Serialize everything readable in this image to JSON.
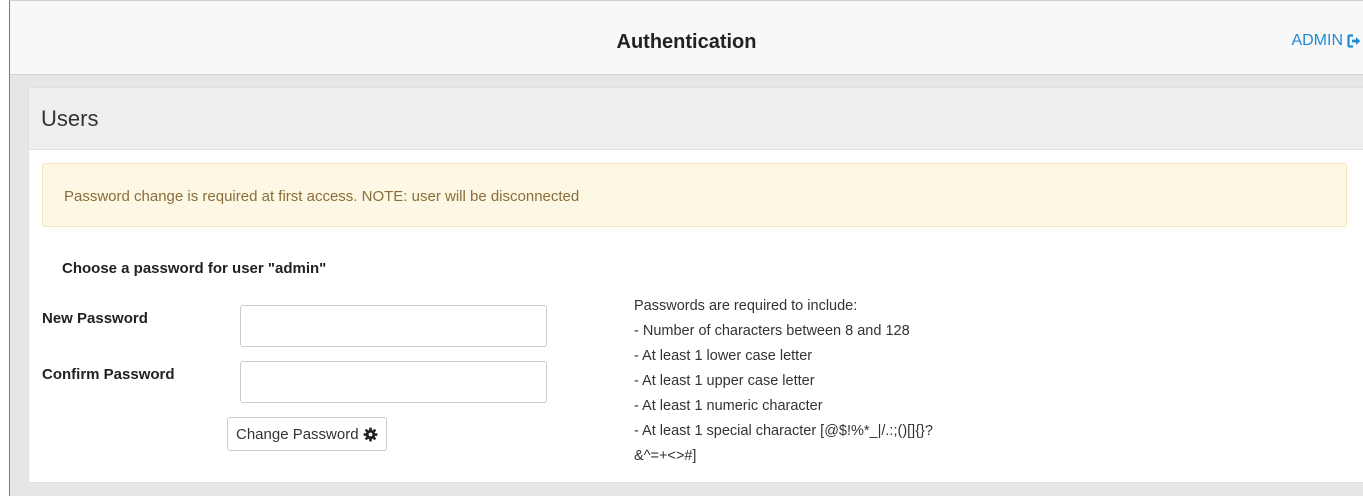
{
  "header": {
    "title": "Authentication",
    "user_label": "ADMIN",
    "logout_icon": "sign-out-icon",
    "link_color": "#1f8ad6"
  },
  "panel": {
    "title": "Users",
    "alert": {
      "text": "Password change is required at first access. NOTE: user will be disconnected",
      "background": "#fcf8e3",
      "text_color": "#8a6d3b"
    },
    "form": {
      "heading": "Choose a password for user \"admin\"",
      "new_password": {
        "label": "New Password",
        "value": "",
        "placeholder": ""
      },
      "confirm_password": {
        "label": "Confirm Password",
        "value": "",
        "placeholder": ""
      },
      "submit": {
        "label": "Change Password",
        "icon": "gear-icon"
      }
    },
    "requirements": {
      "intro": "Passwords are required to include:",
      "items": [
        "- Number of characters between 8 and 128",
        "- At least 1 lower case letter",
        "- At least 1 upper case letter",
        "- At least 1 numeric character",
        "- At least 1 special character [@$!%*_|/.:;()[]{}?",
        "&^=+<>#]"
      ]
    }
  }
}
